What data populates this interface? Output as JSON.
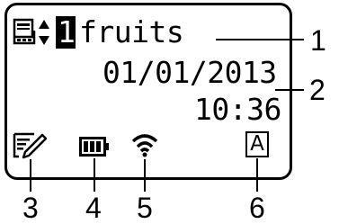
{
  "display": {
    "template_number": "1",
    "template_name": "fruits",
    "date": "01/01/2013",
    "time": "10:36",
    "font_mode_letter": "A"
  },
  "icons": {
    "template_icon": "template-icon",
    "select_arrows_icon": "up-down-arrows-icon",
    "edit_icon": "edit-pencil-icon",
    "battery_icon": "battery-icon",
    "wireless_icon": "wireless-icon",
    "font_mode_icon": "font-mode-a-icon"
  },
  "callouts": {
    "c1": "1",
    "c2": "2",
    "c3": "3",
    "c4": "4",
    "c5": "5",
    "c6": "6"
  }
}
